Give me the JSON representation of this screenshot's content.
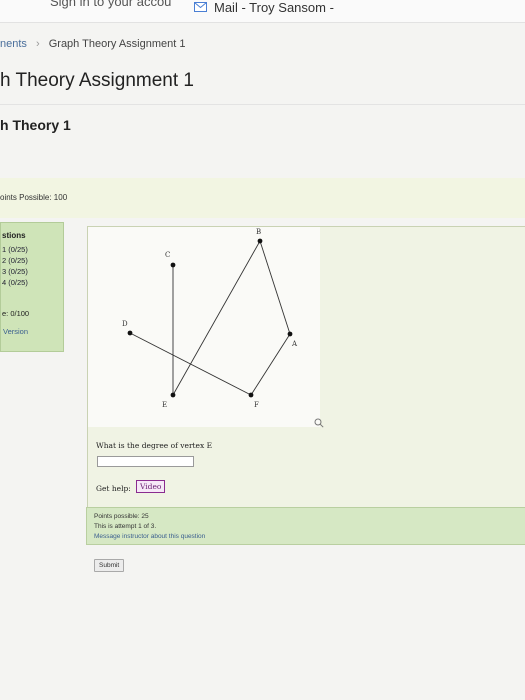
{
  "browser": {
    "tab_left_text": "Sign in to your accou",
    "tab_mail_text": "Mail - Troy Sansom -"
  },
  "breadcrumb": {
    "parent": "nents",
    "current": "Graph Theory Assignment 1"
  },
  "page": {
    "title": "h Theory Assignment 1",
    "subtitle": "h Theory 1",
    "points_possible_total": "oints Possible: 100"
  },
  "sidebar": {
    "heading": "stions",
    "questions": [
      "1 (0/25)",
      "2 (0/25)",
      "3 (0/25)",
      "4 (0/25)"
    ],
    "score": "e: 0/100",
    "version_link": "Version"
  },
  "graph": {
    "vertices": [
      {
        "label": "C"
      },
      {
        "label": "B"
      },
      {
        "label": "D"
      },
      {
        "label": "A"
      },
      {
        "label": "E"
      },
      {
        "label": "F"
      }
    ]
  },
  "question": {
    "prompt": "What is the degree of vertex E",
    "answer_value": "",
    "help_label": "Get help:",
    "video_label": "Video"
  },
  "status": {
    "points_possible": "Points possible: 25",
    "attempt": "This is attempt 1 of 3.",
    "message_link": "Message instructor about this question"
  },
  "actions": {
    "submit_label": "Submit"
  }
}
